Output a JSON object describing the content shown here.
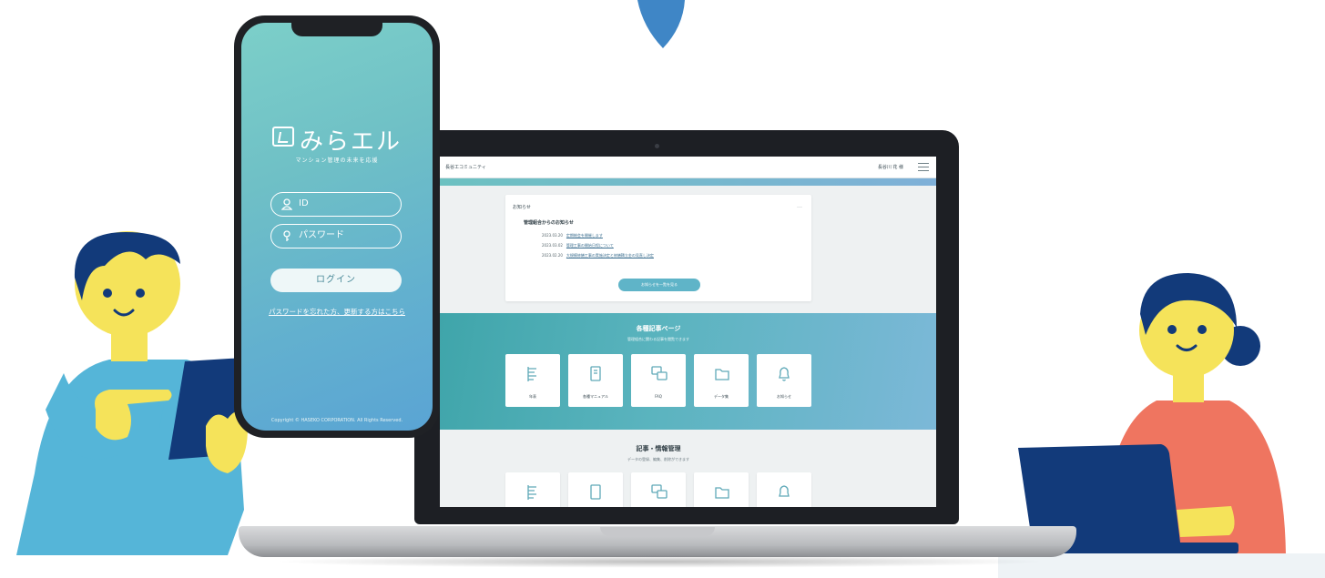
{
  "laptop": {
    "header": {
      "brand": "長谷工コミュニティ",
      "user": "長谷川 花 様"
    },
    "notice": {
      "heading": "お知らせ",
      "subheading": "管理組合からのお知らせ",
      "items": [
        {
          "date": "2023.03.20",
          "title": "定期総会を開催します"
        },
        {
          "date": "2023.03.02",
          "title": "管理工事の開始日程について"
        },
        {
          "date": "2023.02.20",
          "title": "大規模修繕工事の実施決定と修繕積立金の見直し決定"
        }
      ],
      "more_label": "お知らせを一覧を見る"
    },
    "articles": {
      "title": "各種記事ページ",
      "subtitle": "管理組合に関わる記事を閲覧できます",
      "tiles": [
        {
          "label": "年表",
          "icon": "timeline-icon"
        },
        {
          "label": "各種マニュアル",
          "icon": "manual-icon"
        },
        {
          "label": "FAQ",
          "icon": "faq-icon"
        },
        {
          "label": "データ集",
          "icon": "folder-icon"
        },
        {
          "label": "お知らせ",
          "icon": "bell-icon"
        }
      ]
    },
    "management": {
      "title": "記事・情報管理",
      "subtitle": "データの登録、編集、削除ができます"
    }
  },
  "phone": {
    "logo": "みらエル",
    "tagline": "マンション管理の未来を応援",
    "id_placeholder": "ID",
    "password_placeholder": "パスワード",
    "login_label": "ログイン",
    "forgot_link": "パスワードを忘れた方、更新する方はこちら",
    "copyright": "Copyright © HASEKO CORPORATION. All Rights Reserved."
  },
  "colors": {
    "accent_blue": "#3f86c6",
    "teal": "#5fb4c8",
    "person_left_shirt": "#55b5d8",
    "person_right_shirt": "#ef7560",
    "skin": "#f5e35a",
    "hair": "#123a7a"
  }
}
